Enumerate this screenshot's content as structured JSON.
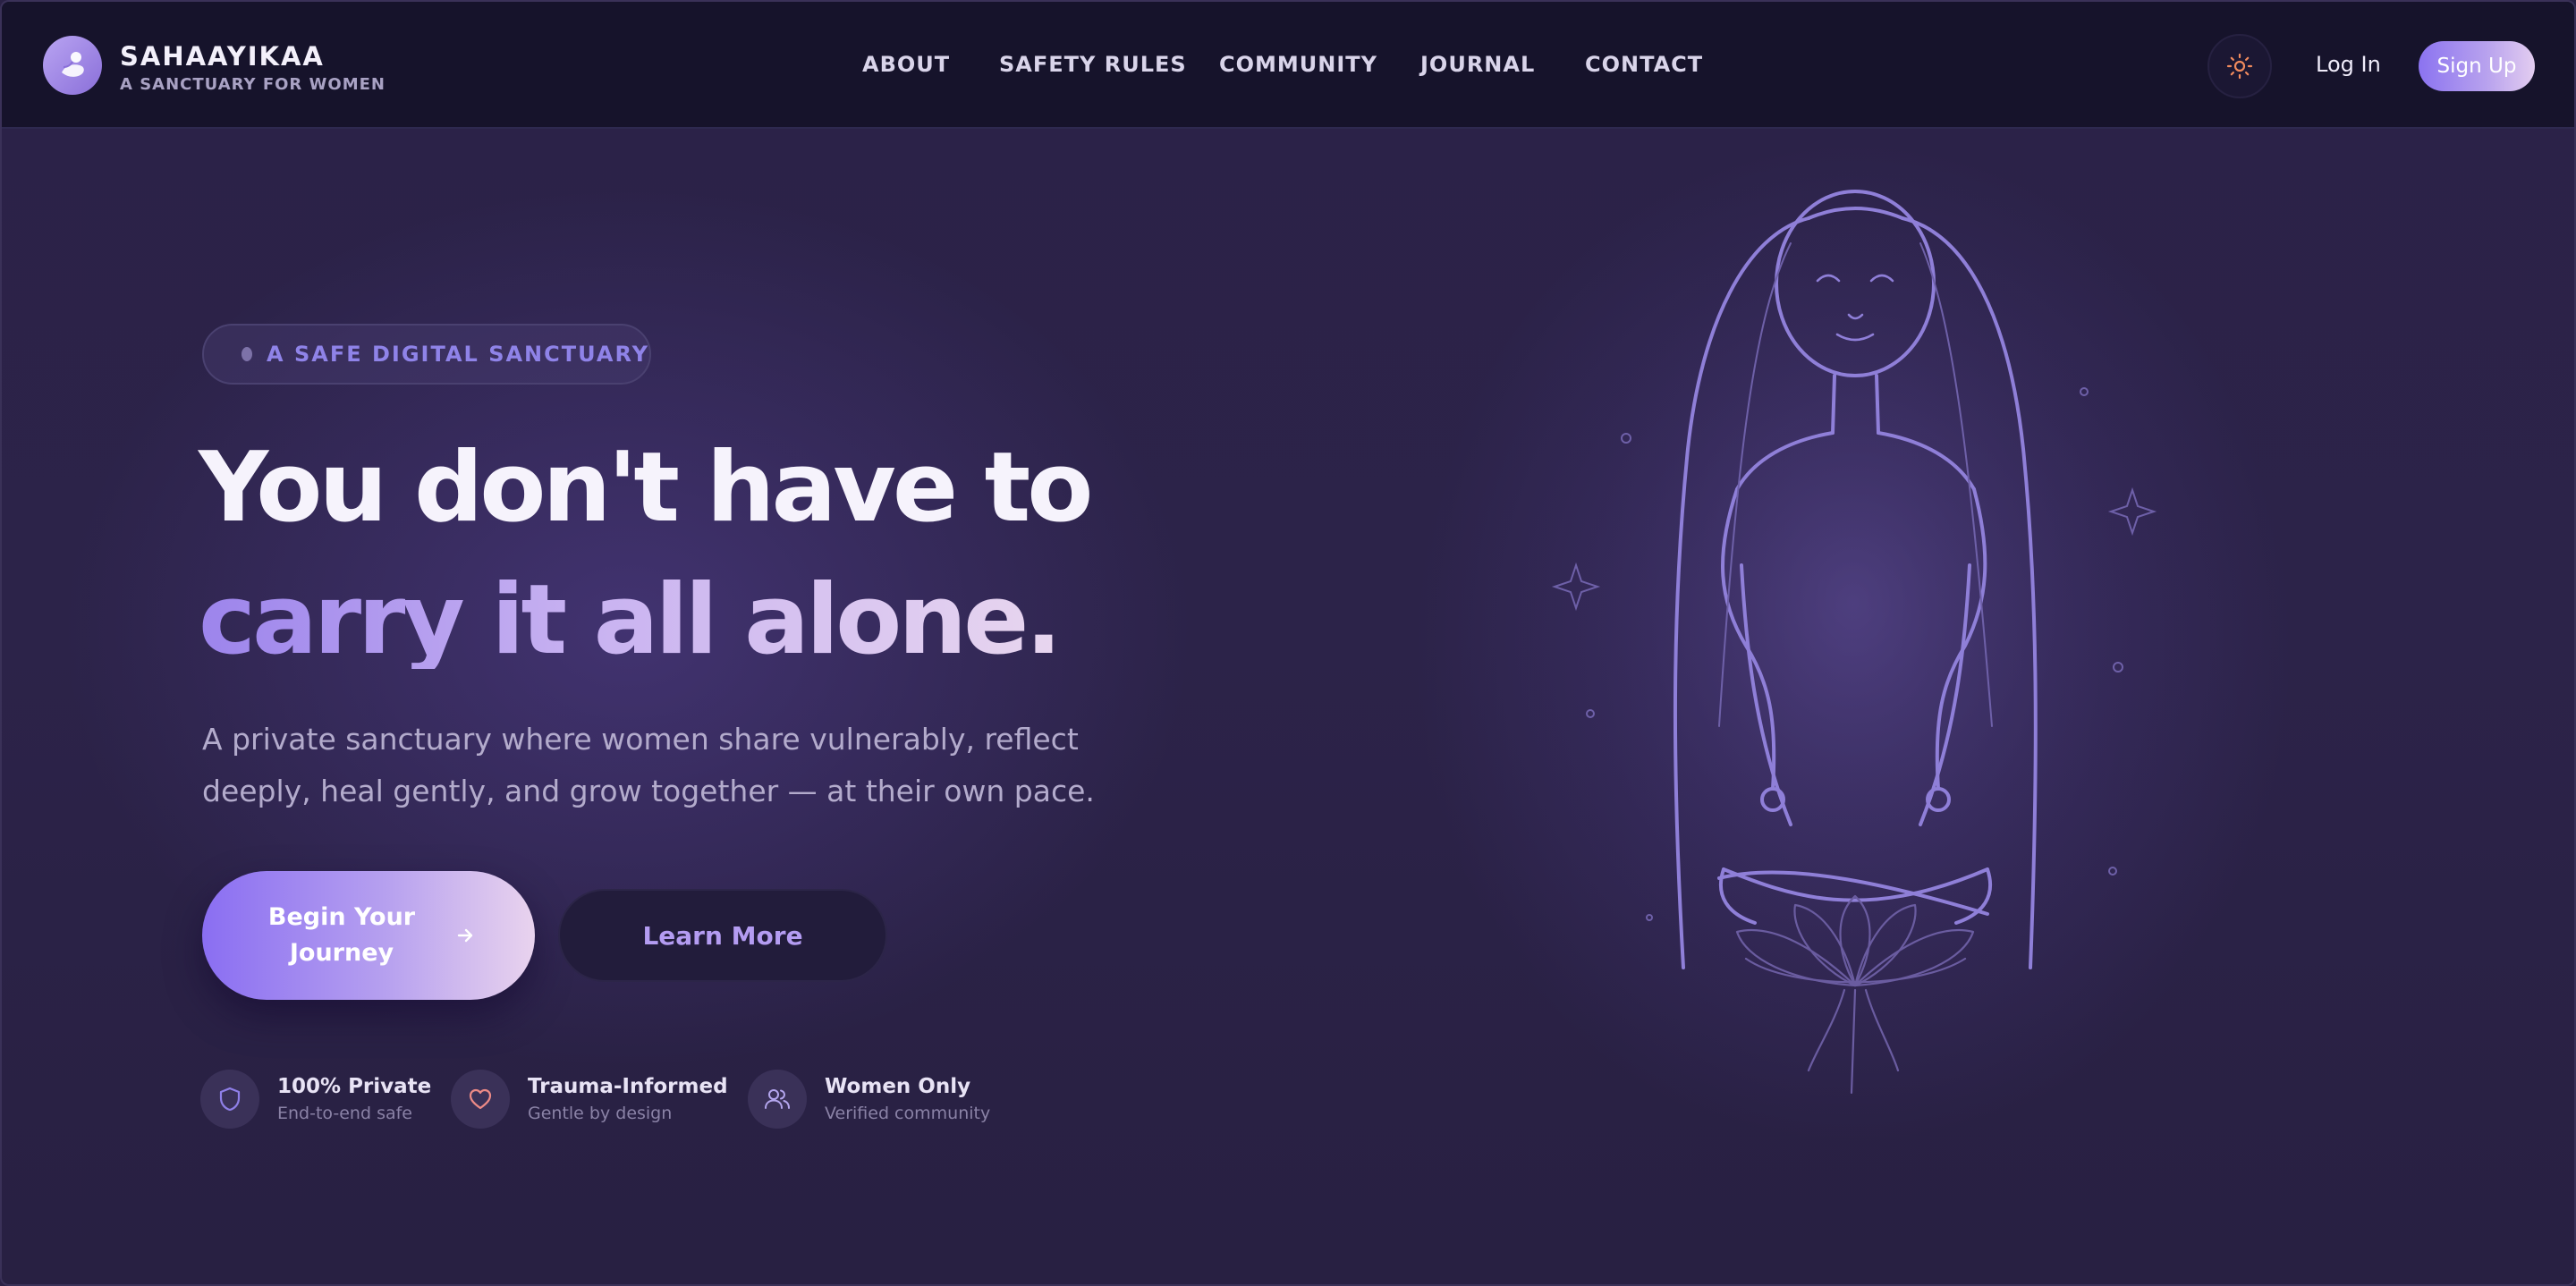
{
  "brand": {
    "name": "SAHAAYIKAA",
    "tagline": "A SANCTUARY FOR WOMEN"
  },
  "nav": {
    "links": [
      "ABOUT",
      "SAFETY RULES",
      "COMMUNITY",
      "JOURNAL",
      "CONTACT"
    ],
    "login_label": "Log In",
    "signup_label": "Sign Up"
  },
  "hero": {
    "badge": "A SAFE DIGITAL SANCTUARY",
    "headline_line1": "You don't have to",
    "headline_line2": "carry it all alone.",
    "subtitle": "A private sanctuary where women share vulnerably, reflect deeply, heal gently, and grow together — at their own pace.",
    "primary_cta": "Begin Your Journey",
    "secondary_cta": "Learn More"
  },
  "features": [
    {
      "title": "100% Private",
      "subtitle": "End-to-end safe",
      "icon": "shield-icon"
    },
    {
      "title": "Trauma-Informed",
      "subtitle": "Gentle by design",
      "icon": "heart-icon"
    },
    {
      "title": "Women Only",
      "subtitle": "Verified community",
      "icon": "users-icon"
    }
  ],
  "colors": {
    "background": "#2b2248",
    "nav_background": "#16132b",
    "accent": "#8b73f0",
    "accent_light": "#e3cdf0",
    "illustration_stroke": "#8f7fd8"
  }
}
